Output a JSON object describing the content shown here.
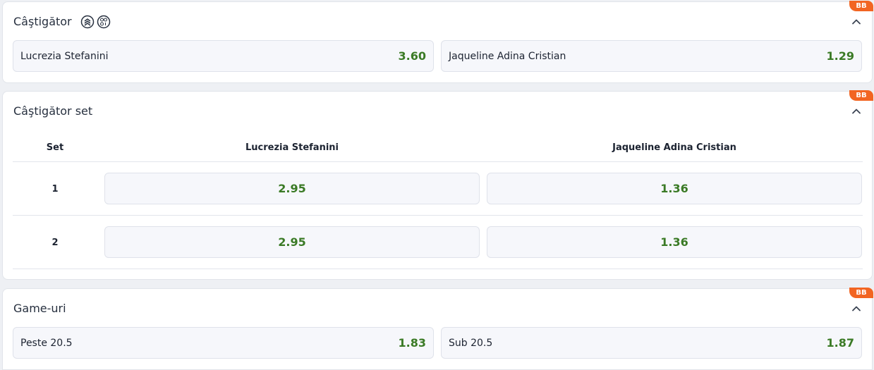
{
  "colors": {
    "odd_value": "#3a7a25",
    "badge": "#f26522",
    "panel_bg": "#ffffff",
    "button_bg": "#f6f7fb"
  },
  "winner": {
    "title": "Câştigător",
    "badge": "BB",
    "icons": [
      "layers-icon",
      "set-score-icon"
    ],
    "collapse_icon": "chevron-up-icon",
    "options": [
      {
        "label": "Lucrezia Stefanini",
        "odd": "3.60"
      },
      {
        "label": "Jaqueline Adina Cristian",
        "odd": "1.29"
      }
    ]
  },
  "set_winner": {
    "title": "Câştigător set",
    "badge": "BB",
    "collapse_icon": "chevron-up-icon",
    "headers": {
      "set": "Set",
      "player1": "Lucrezia Stefanini",
      "player2": "Jaqueline Adina Cristian"
    },
    "rows": [
      {
        "set": "1",
        "odd1": "2.95",
        "odd2": "1.36"
      },
      {
        "set": "2",
        "odd1": "2.95",
        "odd2": "1.36"
      }
    ]
  },
  "games": {
    "title": "Game-uri",
    "badge": "BB",
    "collapse_icon": "chevron-up-icon",
    "options": [
      {
        "label": "Peste 20.5",
        "odd": "1.83"
      },
      {
        "label": "Sub 20.5",
        "odd": "1.87"
      }
    ]
  }
}
